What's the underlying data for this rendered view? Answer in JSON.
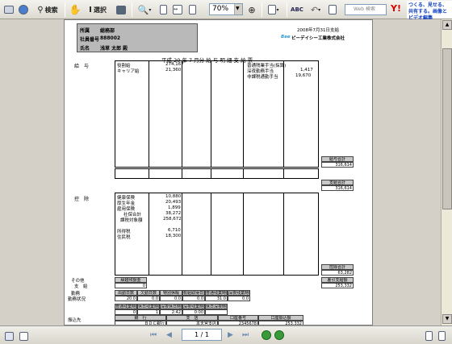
{
  "toolbar": {
    "search_label": "検索",
    "select_label": "選択",
    "zoom_value": "70%",
    "web_search_placeholder": "Web 検索",
    "yahoo_label": "Y!",
    "ad_text": "つくる、見せる、共有する。画像とビデオ編集"
  },
  "document": {
    "header": {
      "department_label": "所属",
      "department_value": "総務部",
      "employee_no_label": "社員番号",
      "employee_no_value": "888002",
      "name_label": "氏名",
      "name_value": "浅草 太郎 殿"
    },
    "pay_date": "2008年7月31日支給",
    "company": "ピーデイシー工業株式会社",
    "company_logo": "Bee",
    "title": "平成 20 年 7 月分 給 与 明 細 支 給 票",
    "section_pay": "給　与",
    "pay_items": [
      {
        "label": "役割給",
        "value": "274,167"
      },
      {
        "label": "キャリア給",
        "value": "21,360"
      }
    ],
    "pay_items_right": [
      {
        "label": "普通残業手当(採算)",
        "value": ""
      },
      {
        "label": "深夜勤務手当",
        "value": "1,417"
      },
      {
        "label": "非課税通勤手当",
        "value": "19,670"
      }
    ],
    "pay_total_label": "給与合計",
    "pay_total_value": "316,614",
    "pay_net_label": "支給合計",
    "pay_net_value": "316,614",
    "section_deduction": "控　除",
    "deduction_items": [
      {
        "label": "健康保険",
        "value": "10,880"
      },
      {
        "label": "厚生年金",
        "value": "20,493"
      },
      {
        "label": "雇用保険",
        "value": "1,899"
      },
      {
        "label": "社保合計",
        "value": "38,272"
      },
      {
        "label": "課税対象額",
        "value": "258,672"
      },
      {
        "label": "所得税",
        "value": "6,710"
      },
      {
        "label": "住民税",
        "value": "18,300"
      }
    ],
    "deduction_total_label": "控除合計",
    "deduction_total_value": "63,282",
    "net_pay_label": "差引支給額",
    "net_pay_value": "253,332",
    "other_label": "その他",
    "pay_label": "支　給",
    "other_box_label": "繰越残額金",
    "other_box_value": "0",
    "attendance_label": "勤務",
    "attendance_status_label": "勤務状況",
    "attendance_headers": [
      "出勤日数",
      "欠勤日数",
      "特別休暇",
      "有給取得日数",
      "普通残業時間",
      "深夜残業時間"
    ],
    "attendance_values": [
      "20.0",
      "0.0",
      "0.0",
      "0.0",
      "31.0",
      "0.0"
    ],
    "attendance2_headers": [
      "普通残業時間",
      "休日残業時間",
      "深夜休日時間",
      "深夜残業時間",
      "休日深夜時間"
    ],
    "attendance2_values": [
      "0",
      "1",
      "2:42",
      "0:00",
      ""
    ],
    "bank_label": "振込先",
    "bank_headers": [
      "銀　行",
      "支　店",
      "口座番号",
      "口座振込額"
    ],
    "bank_values": [
      "ＢＤＣ銀行",
      "本天宮支店",
      "2345678",
      "253,332"
    ]
  },
  "statusbar": {
    "page_indicator": "1 / 1"
  }
}
